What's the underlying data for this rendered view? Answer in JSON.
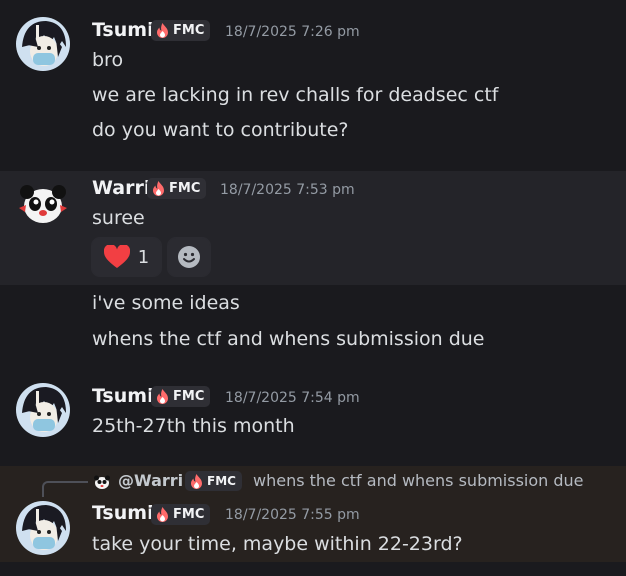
{
  "messages": [
    {
      "username": "Tsumi",
      "tag": "FMC",
      "timestamp": "18/7/2025 7:26 pm",
      "lines": [
        "bro",
        "we are lacking in rev challs for deadsec ctf",
        "do you want to contribute?"
      ]
    },
    {
      "username": "Warri",
      "tag": "FMC",
      "timestamp": "18/7/2025 7:53 pm",
      "lines": [
        "suree"
      ],
      "reaction": {
        "emoji": "heart",
        "count": "1"
      },
      "followups": [
        "i've some ideas",
        "whens the ctf and whens submission due"
      ]
    },
    {
      "username": "Tsumi",
      "tag": "FMC",
      "timestamp": "18/7/2025 7:54 pm",
      "lines": [
        "25th-27th this month"
      ]
    },
    {
      "reply_to": {
        "username": "@Warri",
        "tag": "FMC",
        "text": "whens the ctf and whens submission due"
      },
      "username": "Tsumi",
      "tag": "FMC",
      "timestamp": "18/7/2025 7:55 pm",
      "lines": [
        "take your time, maybe within 22-23rd?"
      ]
    }
  ],
  "colors": {
    "background": "#1a1a1e",
    "hover": "#242429",
    "reply_highlight": "#27221f",
    "heart": "#f23f43",
    "tag_flame": "#ff6b6b"
  }
}
